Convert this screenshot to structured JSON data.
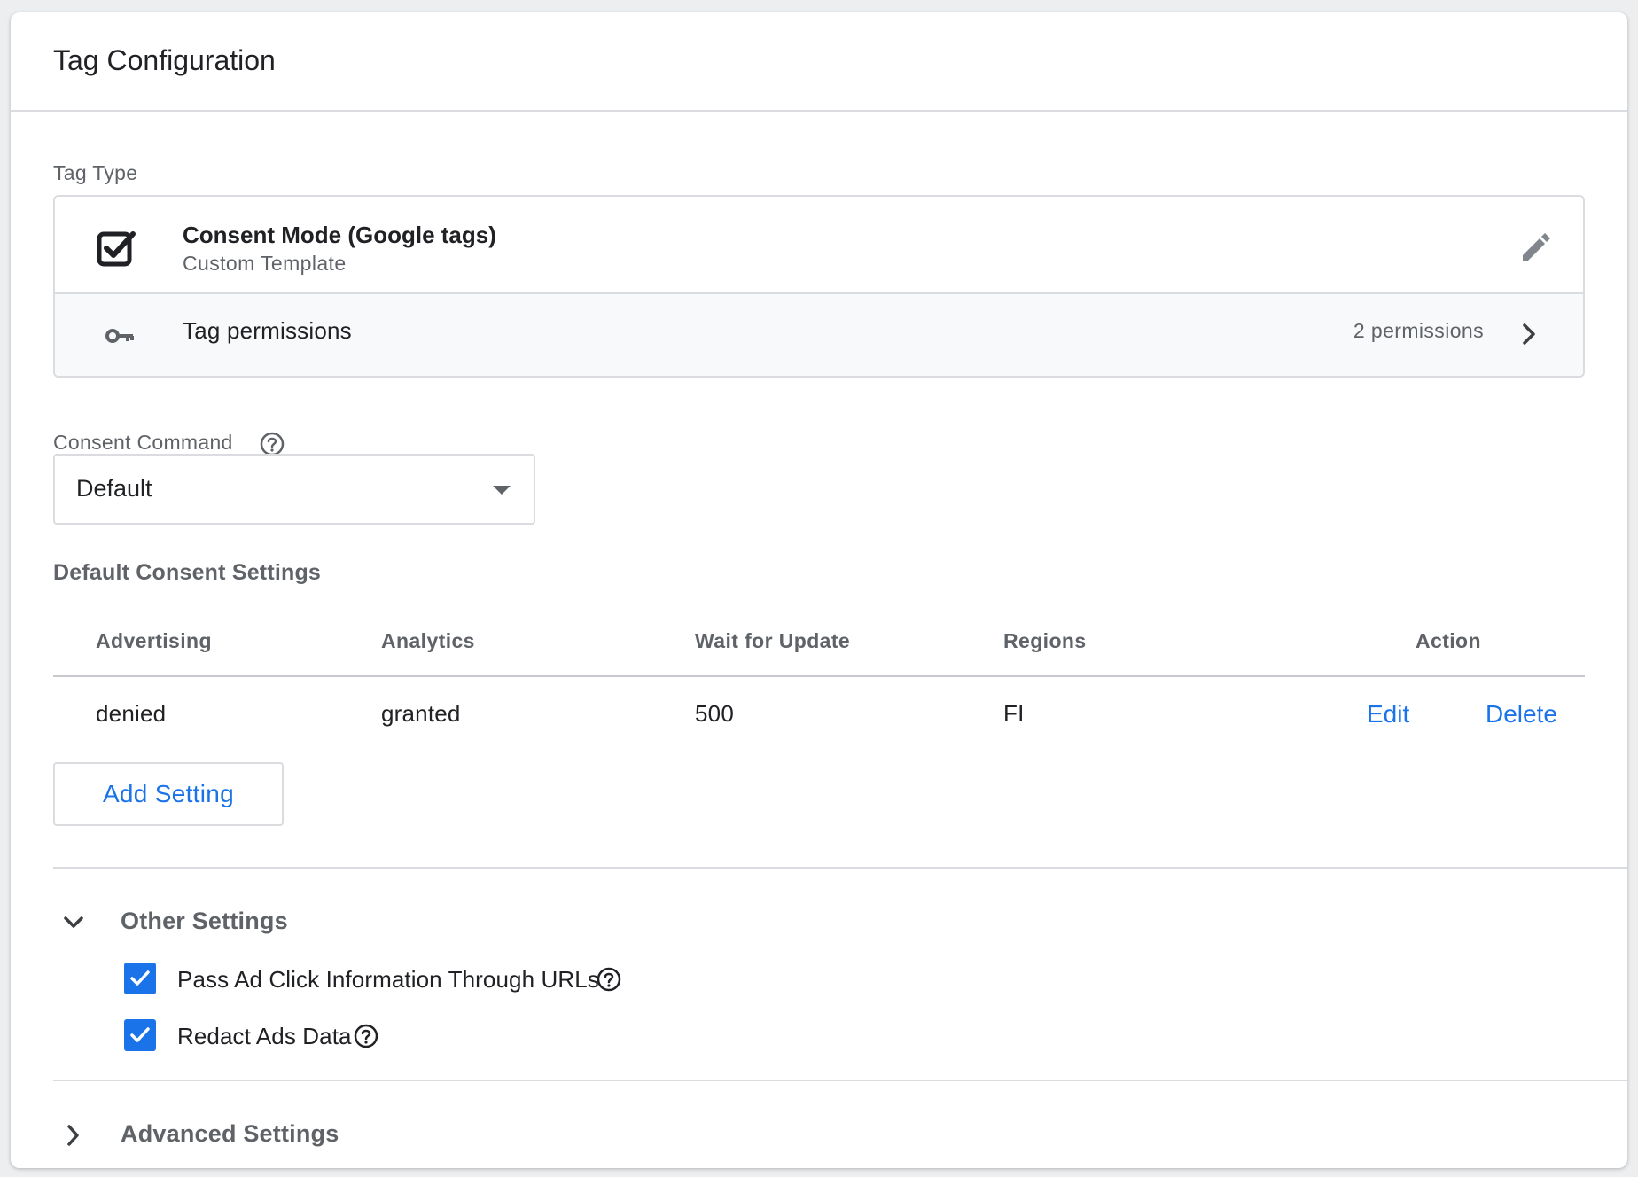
{
  "card": {
    "title": "Tag Configuration"
  },
  "tag_type": {
    "label": "Tag Type",
    "name": "Consent Mode (Google tags)",
    "subtitle": "Custom Template",
    "edit_icon": "pencil-icon",
    "template_icon": "checkbox-checked-icon",
    "permissions": {
      "icon": "key-icon",
      "label": "Tag permissions",
      "count": "2 permissions"
    }
  },
  "consent_command": {
    "label": "Consent Command",
    "selected": "Default"
  },
  "default_consent": {
    "heading": "Default Consent Settings",
    "columns": [
      "Advertising",
      "Analytics",
      "Wait for Update",
      "Regions",
      "Action"
    ],
    "rows": [
      {
        "advertising": "denied",
        "analytics": "granted",
        "wait_for_update": "500",
        "regions": "FI",
        "edit_label": "Edit",
        "delete_label": "Delete"
      }
    ],
    "add_button": "Add Setting"
  },
  "other_settings": {
    "label": "Other Settings",
    "expanded": true,
    "options": [
      {
        "label": "Pass Ad Click Information Through URLs",
        "checked": true
      },
      {
        "label": "Redact Ads Data",
        "checked": true
      }
    ]
  },
  "advanced_settings": {
    "label": "Advanced Settings",
    "expanded": false
  },
  "colors": {
    "accent": "#1a73e8",
    "text_primary": "#202124",
    "text_secondary": "#5f6368",
    "border": "#dadce0"
  }
}
